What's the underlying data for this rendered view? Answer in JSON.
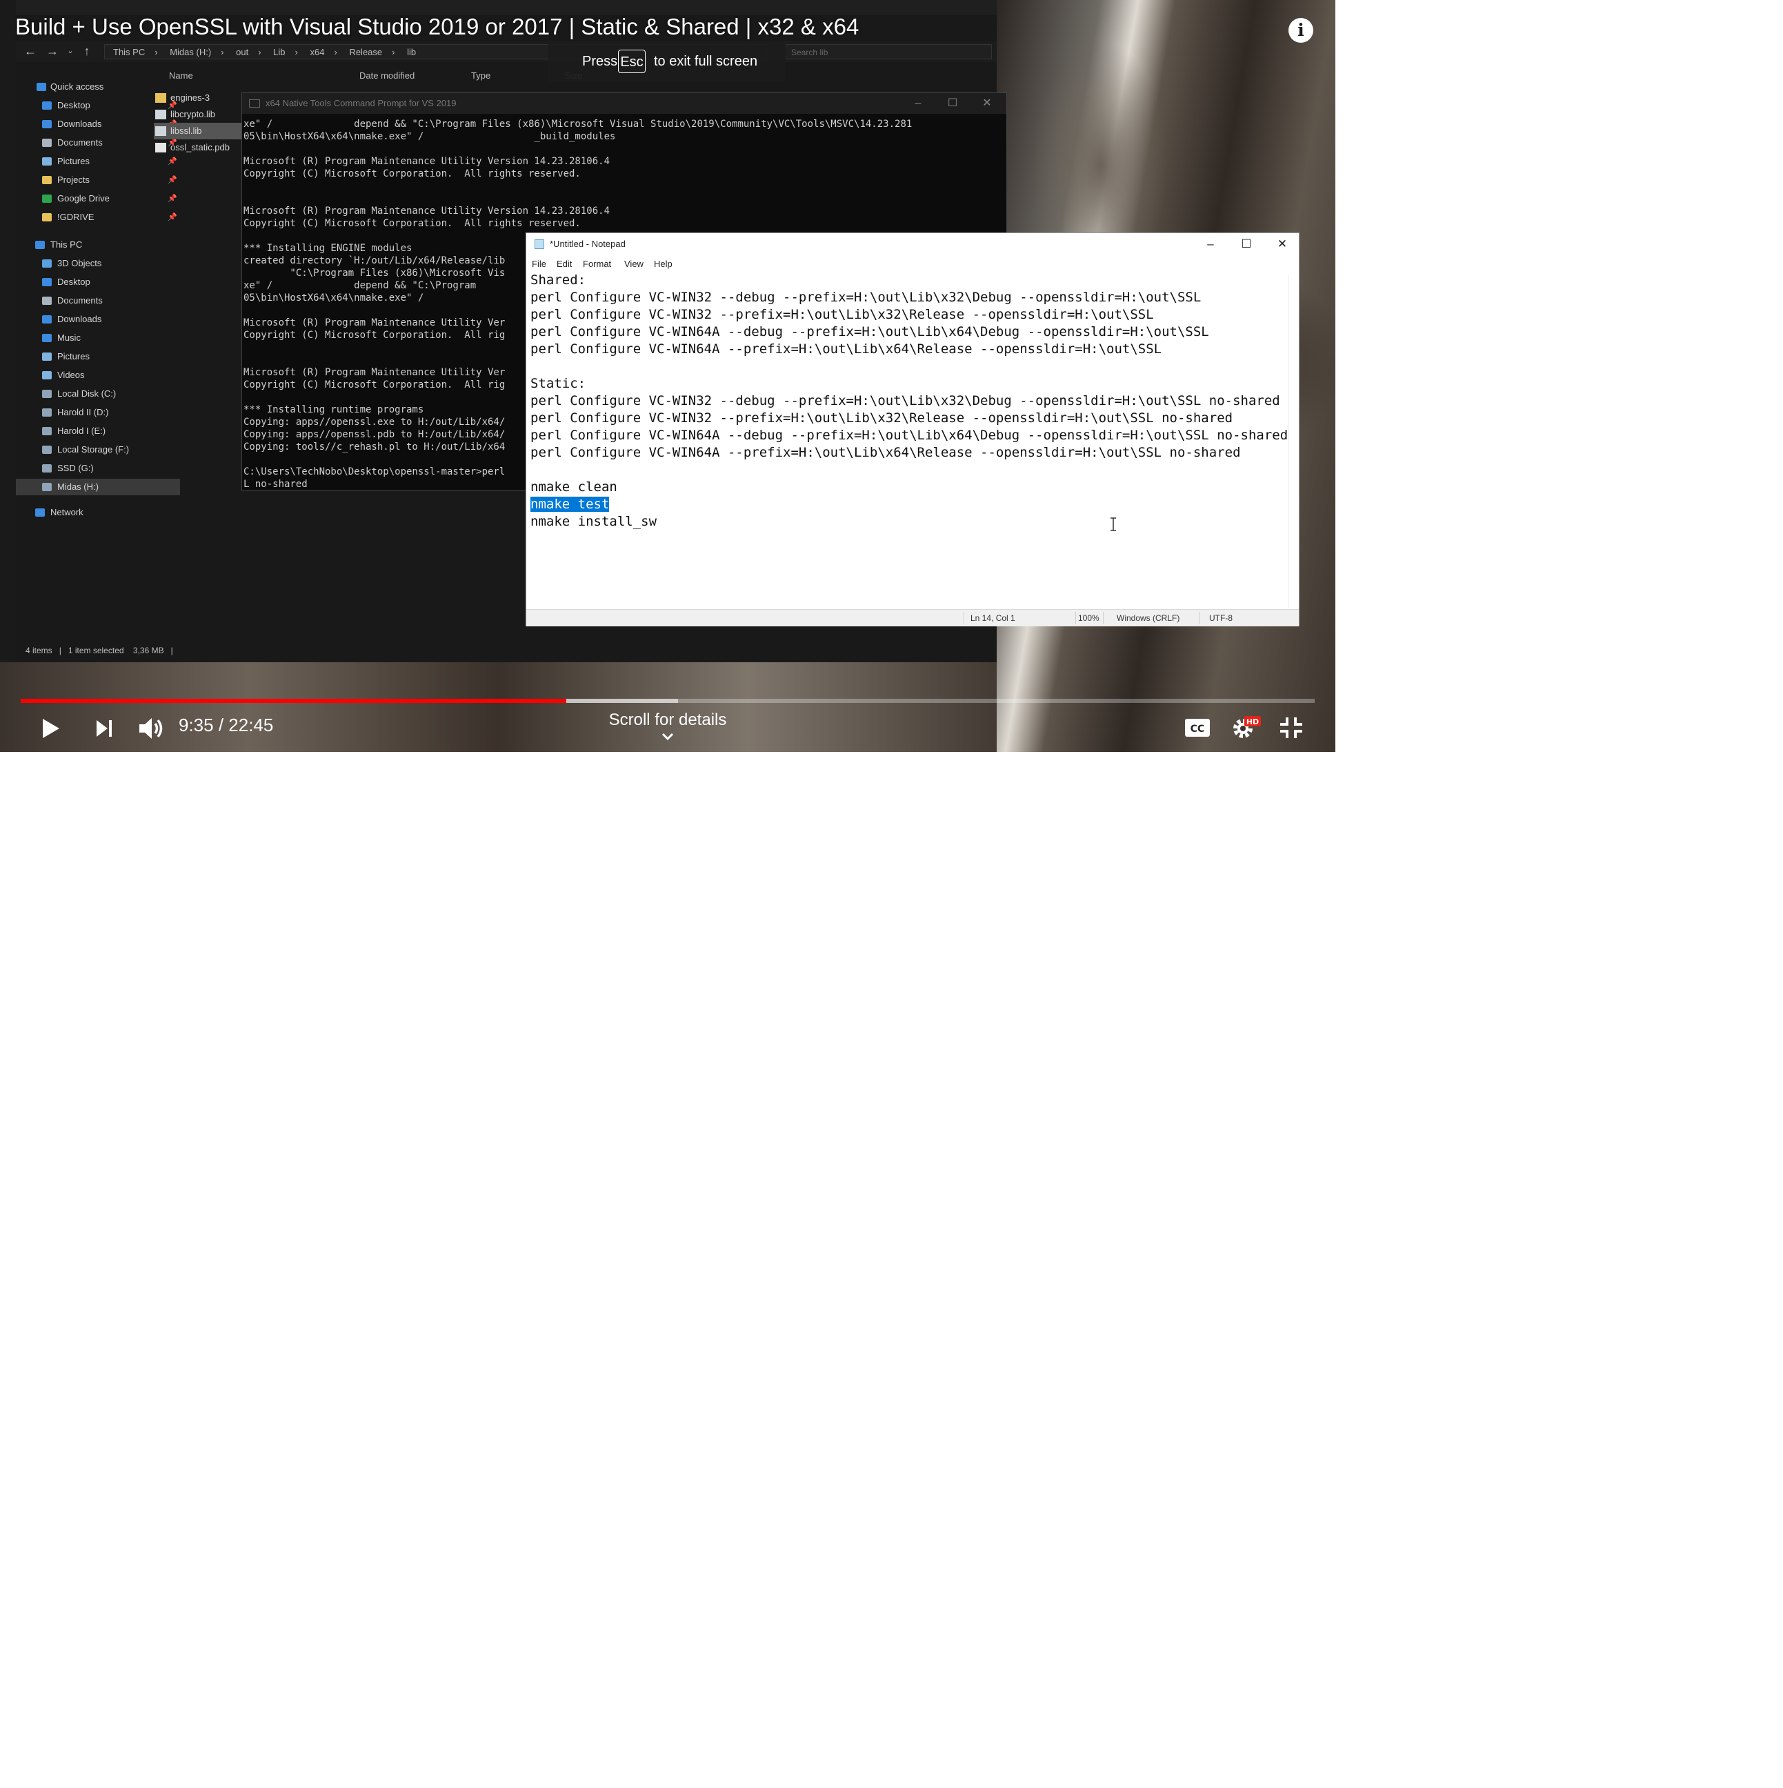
{
  "video": {
    "title": "Build + Use OpenSSL with Visual Studio 2019 or 2017 | Static & Shared | x32 & x64",
    "esc_notice": {
      "before": "Press",
      "key": "Esc",
      "after": "to exit full screen"
    },
    "time_current": "9:35",
    "time_total": "22:45",
    "time_display": "9:35 / 22:45",
    "played_fraction": 0.4214,
    "loaded_fraction": 0.508,
    "scroll_hint": "Scroll for details",
    "hd_badge": "HD",
    "icons": {
      "info": "info-icon",
      "play": "play-icon",
      "next": "next-icon",
      "volume": "volume-icon",
      "captions": "cc-icon",
      "settings": "settings-gear-icon",
      "exit_fullscreen": "exit-fullscreen-icon",
      "chevron": "chevron-down-icon"
    },
    "progress_color": "#ff0000"
  },
  "explorer": {
    "breadcrumb": [
      "This PC",
      "Midas (H:)",
      "out",
      "Lib",
      "x64",
      "Release",
      "lib"
    ],
    "search_placeholder": "Search lib",
    "nav": [
      {
        "label": "Quick access",
        "pin": false
      },
      {
        "label": "Desktop",
        "pin": true
      },
      {
        "label": "Downloads",
        "pin": true
      },
      {
        "label": "Documents",
        "pin": true
      },
      {
        "label": "Pictures",
        "pin": true
      },
      {
        "label": "Projects",
        "pin": true
      },
      {
        "label": "Google Drive",
        "pin": true
      },
      {
        "label": "!GDRIVE",
        "pin": true
      },
      {
        "label": "This PC",
        "pin": false
      },
      {
        "label": "3D Objects",
        "pin": false
      },
      {
        "label": "Desktop",
        "pin": false
      },
      {
        "label": "Documents",
        "pin": false
      },
      {
        "label": "Downloads",
        "pin": false
      },
      {
        "label": "Music",
        "pin": false
      },
      {
        "label": "Pictures",
        "pin": false
      },
      {
        "label": "Videos",
        "pin": false
      },
      {
        "label": "Local Disk (C:)",
        "pin": false
      },
      {
        "label": "Harold II (D:)",
        "pin": false
      },
      {
        "label": "Harold I (E:)",
        "pin": false
      },
      {
        "label": "Local Storage (F:)",
        "pin": false
      },
      {
        "label": "SSD (G:)",
        "pin": false
      },
      {
        "label": "Midas (H:)",
        "pin": false
      },
      {
        "label": "Network",
        "pin": false
      }
    ],
    "columns": [
      "Name",
      "Date modified",
      "Type",
      "Size"
    ],
    "files": [
      "engines-3",
      "libcrypto.lib",
      "libssl.lib",
      "ossl_static.pdb"
    ],
    "status": {
      "items": "4 items",
      "selected": "1 item selected",
      "size": "3,36 MB"
    }
  },
  "cmd": {
    "title": "x64 Native Tools Command Prompt for VS 2019",
    "lines": [
      "xe\" /              depend && \"C:\\Program Files (x86)\\Microsoft Visual Studio\\2019\\Community\\VC\\Tools\\MSVC\\14.23.281",
      "05\\bin\\HostX64\\x64\\nmake.exe\" /                   _build_modules",
      "",
      "Microsoft (R) Program Maintenance Utility Version 14.23.28106.4",
      "Copyright (C) Microsoft Corporation.  All rights reserved.",
      "",
      "",
      "Microsoft (R) Program Maintenance Utility Version 14.23.28106.4",
      "Copyright (C) Microsoft Corporation.  All rights reserved.",
      "",
      "*** Installing ENGINE modules",
      "created directory `H:/out/Lib/x64/Release/lib",
      "        \"C:\\Program Files (x86)\\Microsoft Vis",
      "xe\" /              depend && \"C:\\Program",
      "05\\bin\\HostX64\\x64\\nmake.exe\" /",
      "",
      "Microsoft (R) Program Maintenance Utility Ver",
      "Copyright (C) Microsoft Corporation.  All rig",
      "",
      "",
      "Microsoft (R) Program Maintenance Utility Ver",
      "Copyright (C) Microsoft Corporation.  All rig",
      "",
      "*** Installing runtime programs",
      "Copying: apps//openssl.exe to H:/out/Lib/x64/",
      "Copying: apps//openssl.pdb to H:/out/Lib/x64/",
      "Copying: tools//c_rehash.pl to H:/out/Lib/x64",
      "",
      "C:\\Users\\TechNobo\\Desktop\\openssl-master>perl",
      "L no-shared"
    ]
  },
  "notepad": {
    "title": "*Untitled - Notepad",
    "menu": [
      "File",
      "Edit",
      "Format",
      "View",
      "Help"
    ],
    "lines": [
      "Shared:",
      "perl Configure VC-WIN32 --debug --prefix=H:\\out\\Lib\\x32\\Debug --openssldir=H:\\out\\SSL",
      "perl Configure VC-WIN32 --prefix=H:\\out\\Lib\\x32\\Release --openssldir=H:\\out\\SSL",
      "perl Configure VC-WIN64A --debug --prefix=H:\\out\\Lib\\x64\\Debug --openssldir=H:\\out\\SSL",
      "perl Configure VC-WIN64A --prefix=H:\\out\\Lib\\x64\\Release --openssldir=H:\\out\\SSL",
      "",
      "Static:",
      "perl Configure VC-WIN32 --debug --prefix=H:\\out\\Lib\\x32\\Debug --openssldir=H:\\out\\SSL no-shared",
      "perl Configure VC-WIN32 --prefix=H:\\out\\Lib\\x32\\Release --openssldir=H:\\out\\SSL no-shared",
      "perl Configure VC-WIN64A --debug --prefix=H:\\out\\Lib\\x64\\Debug --openssldir=H:\\out\\SSL no-shared",
      "perl Configure VC-WIN64A --prefix=H:\\out\\Lib\\x64\\Release --openssldir=H:\\out\\SSL no-shared",
      "",
      "nmake clean"
    ],
    "selected_line": "nmake test",
    "last_line": "nmake install_sw",
    "status": {
      "position": "Ln 14, Col 1",
      "zoom": "100%",
      "line_endings": "Windows (CRLF)",
      "encoding": "UTF-8"
    },
    "selection_color": "#0078d7"
  }
}
